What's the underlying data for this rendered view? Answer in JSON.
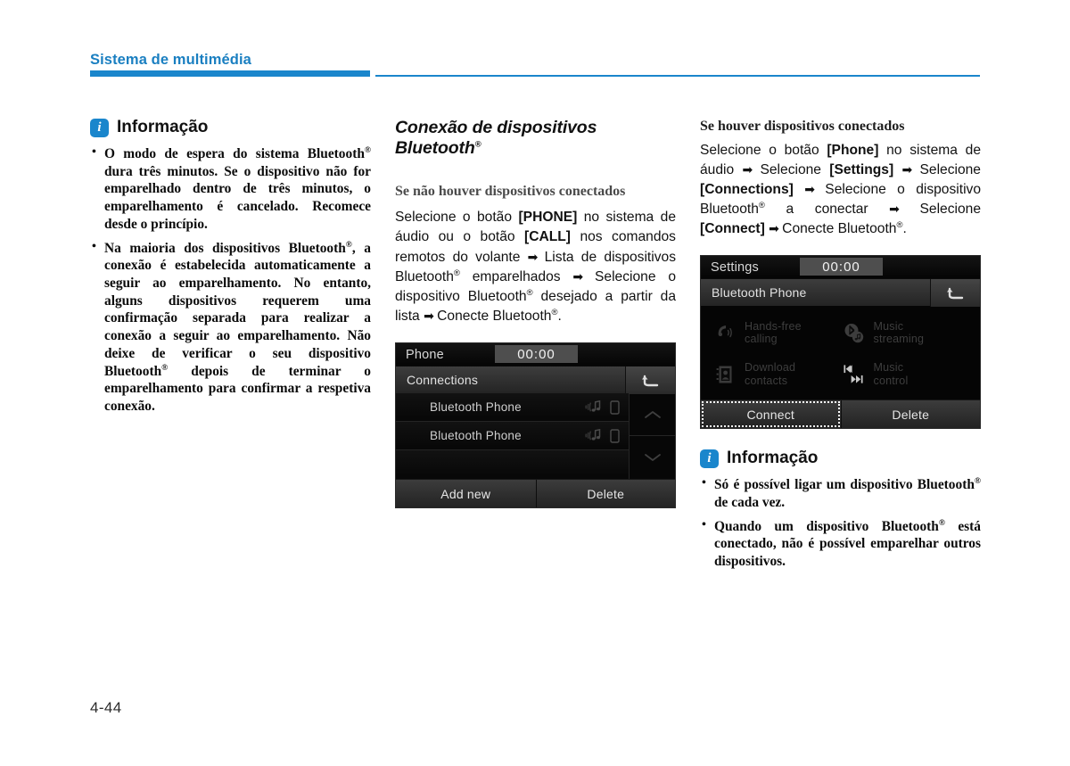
{
  "header": {
    "chapter_title": "Sistema de multimédia",
    "accent_color": "#1a86cc"
  },
  "folio": "4-44",
  "left_column": {
    "info_box": {
      "icon": "info-icon",
      "icon_glyph": "i",
      "title": "Informação",
      "bullets": [
        "O modo de espera do sistema Bluetooth® dura três minutos. Se o dispositivo não for emparelhado dentro de três minutos, o emparelhamento é cancelado. Recomece desde o princípio.",
        "Na maioria dos dispositivos Bluetooth®, a conexão é estabelecida automaticamente a seguir ao emparelhamento. No entanto, alguns dispositivos requerem uma confirmação separada para realizar a conexão a seguir ao emparelhamento. Não deixe de verificar o seu dispositivo Bluetooth® depois de terminar o emparelhamento para confirmar a respetiva conexão."
      ]
    }
  },
  "middle_column": {
    "section_title": "Conexão de dispositivos Bluetooth®",
    "sub_title": "Se não houver dispositivos conectados",
    "body": "Selecione o botão [PHONE] no sistema de áudio ou o botão [CALL] nos comandos remotos do volante ➡ Lista de dispositivos Bluetooth® emparelhados ➡ Selecione o dispositivo Bluetooth® desejado a partir da lista ➡ Conecte Bluetooth®.",
    "screenshot": {
      "title": "Phone",
      "clock": "00:00",
      "subheader": "Connections",
      "back_icon": "back-arrow-icon",
      "rows": [
        {
          "label": "Bluetooth Phone",
          "icons": [
            "music-streaming-icon",
            "phone-device-icon"
          ]
        },
        {
          "label": "Bluetooth Phone",
          "icons": [
            "music-streaming-icon",
            "phone-device-icon"
          ]
        }
      ],
      "scroll_up_icon": "chevron-up-icon",
      "scroll_down_icon": "chevron-down-icon",
      "buttons": [
        {
          "label": "Add new",
          "focused": false
        },
        {
          "label": "Delete",
          "focused": false
        }
      ]
    }
  },
  "right_column": {
    "sub_title": "Se houver dispositivos conectados",
    "body": "Selecione o botão [Phone] no sistema de áudio ➡ Selecione [Settings] ➡ Selecione [Connections] ➡ Selecione o dispositivo Bluetooth® a conectar ➡ Selecione [Connect] ➡ Conecte Bluetooth®.",
    "screenshot": {
      "title": "Settings",
      "clock": "00:00",
      "subheader": "Bluetooth Phone",
      "back_icon": "back-arrow-icon",
      "features": [
        {
          "label_line1": "Hands-free",
          "label_line2": "calling",
          "icon": "handset-calling-icon"
        },
        {
          "label_line1": "Music",
          "label_line2": "streaming",
          "icon": "bluetooth-music-icon"
        },
        {
          "label_line1": "Download",
          "label_line2": "contacts",
          "icon": "contacts-book-icon"
        },
        {
          "label_line1": "Music",
          "label_line2": "control",
          "icon": "track-controls-icon"
        }
      ],
      "buttons": [
        {
          "label": "Connect",
          "focused": true
        },
        {
          "label": "Delete",
          "focused": false
        }
      ]
    },
    "info_box": {
      "icon": "info-icon",
      "icon_glyph": "i",
      "title": "Informação",
      "bullets": [
        "Só é possível ligar um dispositivo Bluetooth® de cada vez.",
        "Quando um dispositivo Bluetooth® está conectado, não é possível emparelhar outros dispositivos."
      ]
    }
  }
}
